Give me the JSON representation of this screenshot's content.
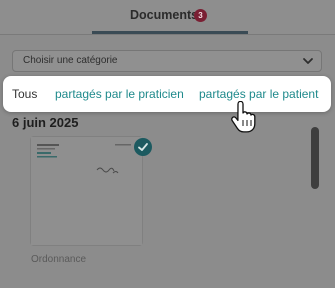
{
  "header": {
    "title": "Documents",
    "badge_count": "3"
  },
  "category_select": {
    "value": "Choisir une catégorie",
    "icon": "chevron-down-icon"
  },
  "filter_options": [
    {
      "label": "Tous"
    },
    {
      "label": "partagés par le praticien"
    },
    {
      "label": "partagés par le patient"
    }
  ],
  "date_group": "6 juin 2025",
  "document": {
    "label": "Ordonnance",
    "selected": true
  },
  "colors": {
    "accent": "#1f8a8c",
    "badge": "#7a1f33",
    "check": "#1c5a60",
    "overlay": "#8c8c8c"
  }
}
